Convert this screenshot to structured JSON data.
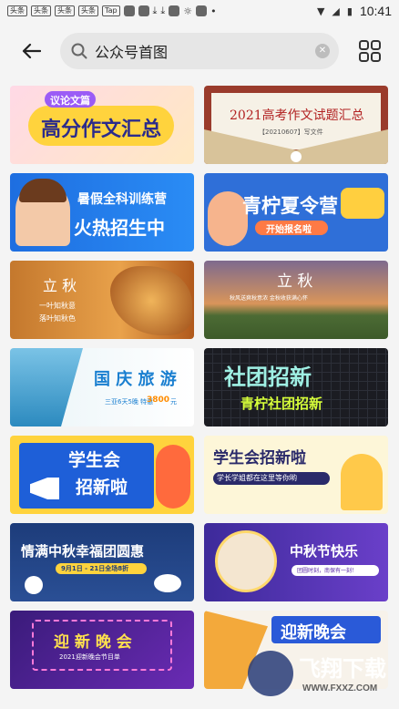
{
  "status_bar": {
    "time": "10:41",
    "left_chips": [
      "头条",
      "头条",
      "头条",
      "头条",
      "Tap"
    ]
  },
  "search": {
    "query": "公众号首图"
  },
  "cards": [
    {
      "tag": "议论文篇",
      "title": "高分作文汇总"
    },
    {
      "title": "2021高考作文试题汇总",
      "subtitle": "【20210607】写文件"
    },
    {
      "title": "暑假全科训练营",
      "title2": "火热招生中"
    },
    {
      "title": "青柠夏令营",
      "button": "开始报名啦"
    },
    {
      "title": "立 秋",
      "line1": "一叶知秋意",
      "line2": "落叶知秋色"
    },
    {
      "title": "立 秋",
      "line1": "秋风送爽秋意浓 金秋收获满心怀"
    },
    {
      "title": "国 庆 旅 游",
      "line1": "三亚6天5晚 特惠",
      "price": "3800",
      "unit": "元"
    },
    {
      "title": "社团招新",
      "subtitle": "青柠社团招新"
    },
    {
      "title": "学生会",
      "title2": "招新啦"
    },
    {
      "title": "学生会招新啦",
      "subtitle": "学长学姐都在这里等你哟"
    },
    {
      "title": "情满中秋幸福团圆惠",
      "subtitle": "9月1日 - 21日全场8折"
    },
    {
      "title": "中秋节快乐",
      "subtitle": "团圆时刻，南保有一刻！"
    },
    {
      "title": "迎 新 晚 会",
      "subtitle": "2021迎新晚会节目单"
    },
    {
      "title": "迎新晚会"
    }
  ],
  "watermark": {
    "main": "飞翔下载",
    "url": "WWW.FXXZ.COM"
  },
  "colors": {
    "accent_blue": "#1e6ee0",
    "yellow": "#ffd33d",
    "purple": "#5b2aa8"
  }
}
